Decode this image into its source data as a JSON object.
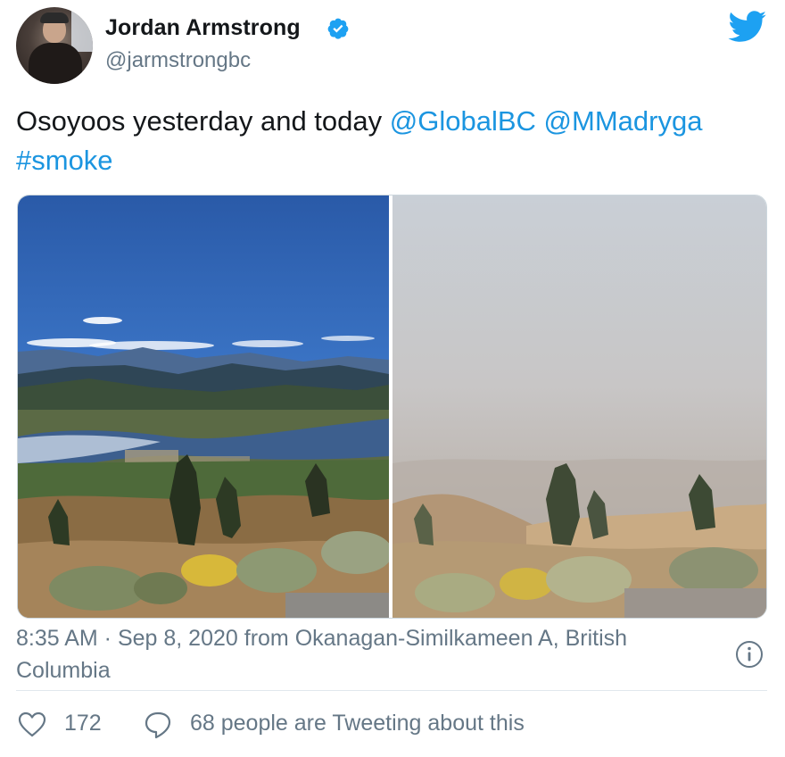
{
  "author": {
    "name": "Jordan Armstrong",
    "handle": "@jarmstrongbc",
    "verified": true
  },
  "tweet": {
    "text_plain": "Osoyoos yesterday and today ",
    "mentions": [
      "@GlobalBC",
      "@MMadryga"
    ],
    "hashtag": "#smoke"
  },
  "media": {
    "photos": [
      "clear-valley-lake-photo",
      "smoke-haze-valley-photo"
    ]
  },
  "meta": {
    "time": "8:35 AM",
    "separator": " · ",
    "date": "Sep 8, 2020",
    "source": " from Okanagan-Similkameen A, British Columbia"
  },
  "actions": {
    "like_count": "172",
    "talk_text": "68 people are Tweeting about this"
  },
  "colors": {
    "link": "#1b95e0",
    "secondary_text": "#657786",
    "twitter_blue": "#1da1f2"
  },
  "icons": [
    "verified-icon",
    "twitter-logo-icon",
    "info-icon",
    "heart-icon",
    "reply-icon"
  ]
}
